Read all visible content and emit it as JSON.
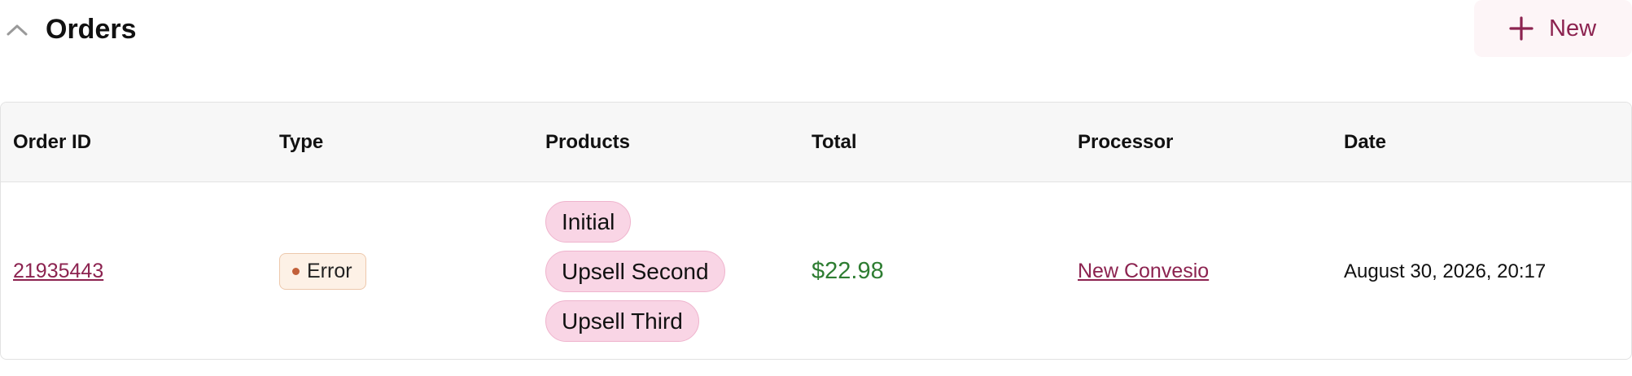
{
  "header": {
    "title": "Orders",
    "new_label": "New"
  },
  "table": {
    "columns": [
      "Order ID",
      "Type",
      "Products",
      "Total",
      "Processor",
      "Date"
    ],
    "rows": [
      {
        "order_id": "21935443",
        "type": "Error",
        "products": [
          "Initial",
          "Upsell Second",
          "Upsell Third"
        ],
        "total": "$22.98",
        "processor": "New Convesio",
        "date": "August 30, 2026, 20:17"
      }
    ]
  },
  "colors": {
    "accent": "#8c2350",
    "total_green": "#2e7d32",
    "error_dot": "#c2603a",
    "product_pill_bg": "#f9d5e5"
  }
}
